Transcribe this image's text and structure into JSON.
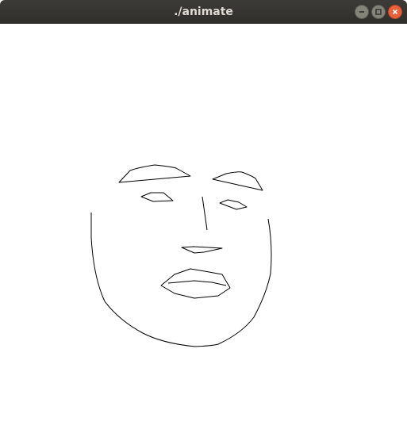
{
  "window": {
    "title": "./animate"
  },
  "icons": {
    "minimize": "minimize-icon",
    "maximize": "maximize-icon",
    "close": "close-icon"
  },
  "colors": {
    "titlebar": "#3c3b37",
    "close_button": "#e8613a",
    "stroke": "#000000",
    "canvas": "#ffffff"
  }
}
